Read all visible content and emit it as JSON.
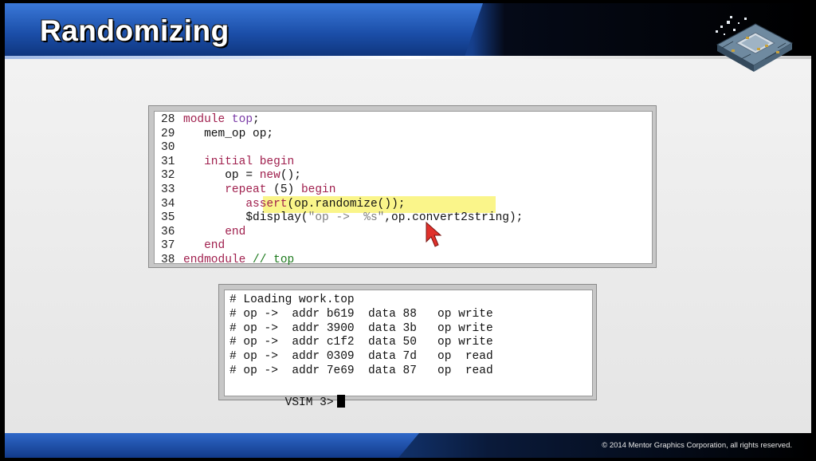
{
  "slide": {
    "title": "Randomizing",
    "copyright": "© 2014 Mentor Graphics Corporation, all rights reserved."
  },
  "code": {
    "lines": [
      {
        "num": "28",
        "segments": [
          {
            "t": "module ",
            "c": "kw"
          },
          {
            "t": "top",
            "c": "tag"
          },
          {
            "t": ";",
            "c": ""
          }
        ]
      },
      {
        "num": "29",
        "segments": [
          {
            "t": "   mem_op op;",
            "c": ""
          }
        ]
      },
      {
        "num": "30",
        "segments": []
      },
      {
        "num": "31",
        "segments": [
          {
            "t": "   initial begin",
            "c": "kw"
          }
        ]
      },
      {
        "num": "32",
        "segments": [
          {
            "t": "      op = ",
            "c": ""
          },
          {
            "t": "new",
            "c": "kw"
          },
          {
            "t": "();",
            "c": ""
          }
        ]
      },
      {
        "num": "33",
        "segments": [
          {
            "t": "      repeat",
            "c": "kw"
          },
          {
            "t": " (5) ",
            "c": ""
          },
          {
            "t": "begin",
            "c": "kw"
          }
        ]
      },
      {
        "num": "34",
        "segments": [
          {
            "t": "         ",
            "c": ""
          },
          {
            "t": "assert",
            "c": "kw"
          },
          {
            "t": "(op.randomize());",
            "c": ""
          }
        ]
      },
      {
        "num": "35",
        "segments": [
          {
            "t": "         $display(",
            "c": ""
          },
          {
            "t": "\"op ->  %s\"",
            "c": "str"
          },
          {
            "t": ",op.convert2string);",
            "c": ""
          }
        ]
      },
      {
        "num": "36",
        "segments": [
          {
            "t": "      end",
            "c": "kw"
          }
        ]
      },
      {
        "num": "37",
        "segments": [
          {
            "t": "   end",
            "c": "kw"
          }
        ]
      },
      {
        "num": "38",
        "segments": [
          {
            "t": "endmodule",
            "c": "kw"
          },
          {
            "t": " // top",
            "c": "cm"
          }
        ]
      }
    ],
    "highlighted_line": "34"
  },
  "console": {
    "lines": [
      "# Loading work.top",
      "# op ->  addr b619  data 88   op write",
      "# op ->  addr 3900  data 3b   op write",
      "# op ->  addr c1f2  data 50   op write",
      "# op ->  addr 0309  data 7d   op  read",
      "# op ->  addr 7e69  data 87   op  read"
    ],
    "prompt": "VSIM 3>"
  },
  "icons": {
    "logo": "chip-circuit-logo",
    "pointer": "mouse-pointer-icon"
  },
  "colors": {
    "keyword": "#a0204e",
    "module_name": "#7a3aa6",
    "comment": "#1d7a1d",
    "string": "#7f7f7f",
    "highlight": "#faf58a",
    "header_blue": "#1b4ea8",
    "pointer_red": "#e0312b"
  }
}
